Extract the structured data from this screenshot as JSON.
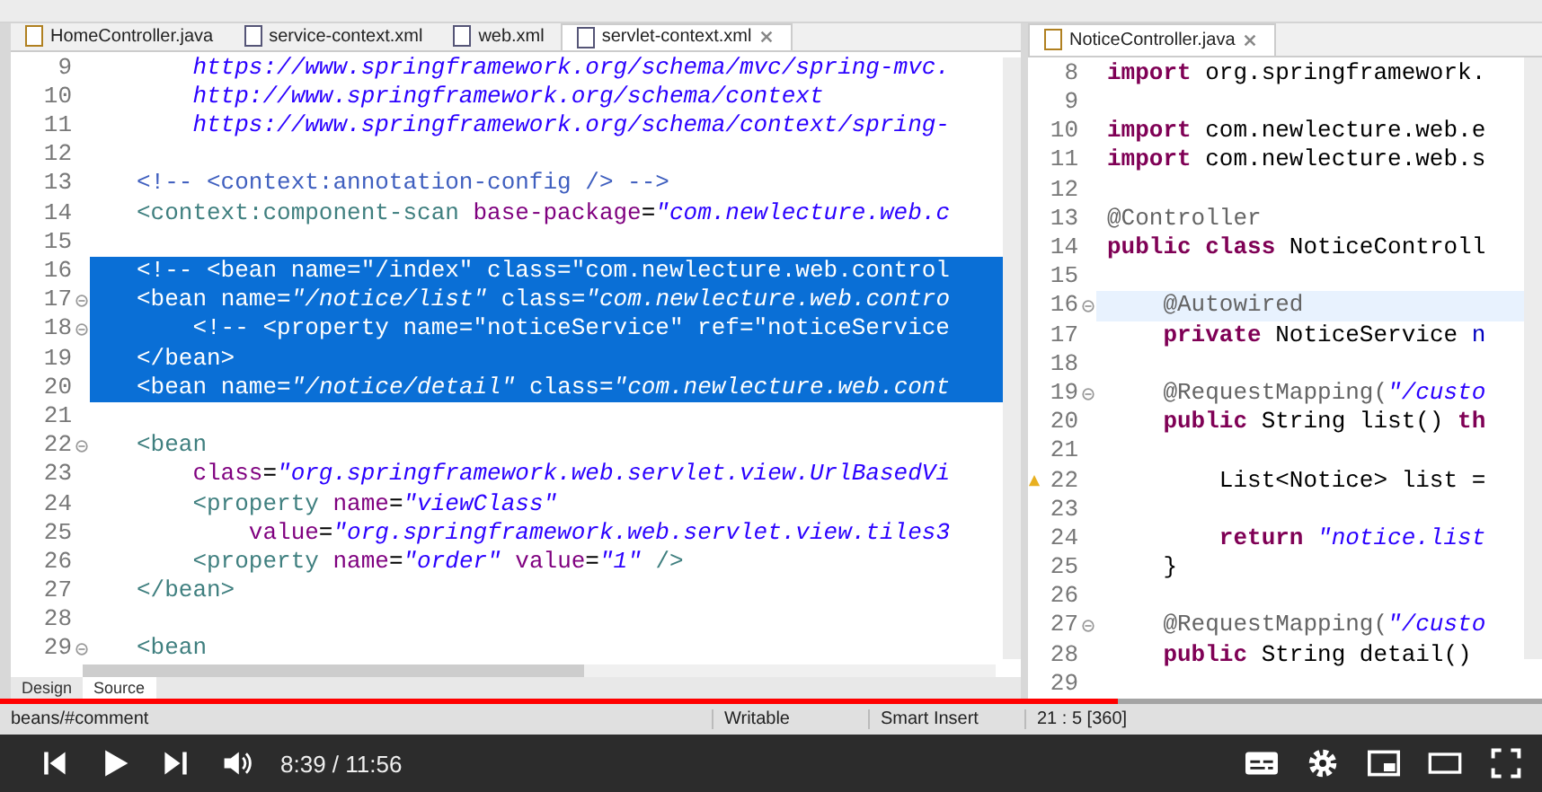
{
  "left_editor": {
    "tabs": [
      {
        "label": "HomeController.java",
        "kind": "java",
        "selected": false
      },
      {
        "label": "service-context.xml",
        "kind": "xml",
        "selected": false
      },
      {
        "label": "web.xml",
        "kind": "xml",
        "selected": false
      },
      {
        "label": "servlet-context.xml",
        "kind": "xml",
        "selected": true
      }
    ],
    "lines": [
      {
        "n": "9",
        "selected": false,
        "fold": false,
        "t": [
          {
            "kind": "value",
            "text": "    https://www.springframework.org/schema/mvc/spring-mvc."
          }
        ]
      },
      {
        "n": "10",
        "selected": false,
        "fold": false,
        "t": [
          {
            "kind": "value",
            "text": "    http://www.springframework.org/schema/context"
          }
        ]
      },
      {
        "n": "11",
        "selected": false,
        "fold": false,
        "t": [
          {
            "kind": "value",
            "text": "    https://www.springframework.org/schema/context/spring-"
          }
        ]
      },
      {
        "n": "12",
        "selected": false,
        "fold": false
      },
      {
        "n": "13",
        "selected": false,
        "fold": false,
        "t": [
          {
            "kind": "comment",
            "text": "<!-- <context:annotation-config /> -->"
          }
        ]
      },
      {
        "n": "14",
        "selected": false,
        "fold": false,
        "t": [
          {
            "kind": "tag",
            "text": "<context:component-scan"
          },
          {
            "kind": "attr",
            "text": " base-package"
          },
          {
            "kind": "plain",
            "text": "="
          },
          {
            "kind": "value",
            "text": "\"com.newlecture.web.c"
          }
        ]
      },
      {
        "n": "15",
        "selected": false,
        "fold": false
      },
      {
        "n": "16",
        "selected": true,
        "fold": false,
        "t": [
          {
            "kind": "comment",
            "text": "<!-- <bean name=\"/index\" class=\"com.newlecture.web.control"
          }
        ]
      },
      {
        "n": "17",
        "selected": true,
        "fold": true,
        "t": [
          {
            "kind": "tag",
            "text": "<bean"
          },
          {
            "kind": "attr",
            "text": " name"
          },
          {
            "kind": "plain",
            "text": "="
          },
          {
            "kind": "value",
            "text": "\"/notice/list\""
          },
          {
            "kind": "attr",
            "text": " class"
          },
          {
            "kind": "plain",
            "text": "="
          },
          {
            "kind": "value",
            "text": "\"com.newlecture.web.contro"
          }
        ]
      },
      {
        "n": "18",
        "selected": true,
        "fold": true,
        "t": [
          {
            "kind": "comment",
            "text": "    <!-- <property name=\"noticeService\" ref=\"noticeService"
          }
        ]
      },
      {
        "n": "19",
        "selected": true,
        "fold": false,
        "t": [
          {
            "kind": "tag",
            "text": "</bean>"
          }
        ]
      },
      {
        "n": "20",
        "selected": true,
        "fold": false,
        "t": [
          {
            "kind": "tag",
            "text": "<bean"
          },
          {
            "kind": "attr",
            "text": " name"
          },
          {
            "kind": "plain",
            "text": "="
          },
          {
            "kind": "value",
            "text": "\"/notice/detail\""
          },
          {
            "kind": "attr",
            "text": " class"
          },
          {
            "kind": "plain",
            "text": "="
          },
          {
            "kind": "value",
            "text": "\"com.newlecture.web.cont"
          }
        ]
      },
      {
        "n": "21",
        "selected": false,
        "fold": false
      },
      {
        "n": "22",
        "selected": false,
        "fold": true,
        "t": [
          {
            "kind": "tag",
            "text": "<bean"
          }
        ]
      },
      {
        "n": "23",
        "selected": false,
        "fold": false,
        "t": [
          {
            "kind": "attr",
            "text": "    class"
          },
          {
            "kind": "plain",
            "text": "="
          },
          {
            "kind": "value",
            "text": "\"org.springframework.web.servlet.view.UrlBasedVi"
          }
        ]
      },
      {
        "n": "24",
        "selected": false,
        "fold": false,
        "t": [
          {
            "kind": "tag",
            "text": "    <property"
          },
          {
            "kind": "attr",
            "text": " name"
          },
          {
            "kind": "plain",
            "text": "="
          },
          {
            "kind": "value",
            "text": "\"viewClass\""
          }
        ]
      },
      {
        "n": "25",
        "selected": false,
        "fold": false,
        "t": [
          {
            "kind": "attr",
            "text": "        value"
          },
          {
            "kind": "plain",
            "text": "="
          },
          {
            "kind": "value",
            "text": "\"org.springframework.web.servlet.view.tiles3"
          }
        ]
      },
      {
        "n": "26",
        "selected": false,
        "fold": false,
        "t": [
          {
            "kind": "tag",
            "text": "    <property"
          },
          {
            "kind": "attr",
            "text": " name"
          },
          {
            "kind": "plain",
            "text": "="
          },
          {
            "kind": "value",
            "text": "\"order\""
          },
          {
            "kind": "attr",
            "text": " value"
          },
          {
            "kind": "plain",
            "text": "="
          },
          {
            "kind": "value",
            "text": "\"1\""
          },
          {
            "kind": "tag",
            "text": " />"
          }
        ]
      },
      {
        "n": "27",
        "selected": false,
        "fold": false,
        "t": [
          {
            "kind": "tag",
            "text": "</bean>"
          }
        ]
      },
      {
        "n": "28",
        "selected": false,
        "fold": false
      },
      {
        "n": "29",
        "selected": false,
        "fold": true,
        "t": [
          {
            "kind": "tag",
            "text": "<bean"
          }
        ]
      }
    ],
    "bottom_tabs": [
      {
        "label": "Design",
        "selected": false
      },
      {
        "label": "Source",
        "selected": true
      }
    ]
  },
  "right_editor": {
    "tabs": [
      {
        "label": "NoticeController.java",
        "kind": "java",
        "selected": true
      }
    ],
    "lines": [
      {
        "n": "8",
        "selected": false,
        "fold": false,
        "warning": false,
        "t": [
          {
            "kind": "keyword",
            "text": "import"
          },
          {
            "kind": "plain",
            "text": " org.springframework."
          }
        ]
      },
      {
        "n": "9",
        "selected": false,
        "fold": false,
        "warning": false
      },
      {
        "n": "10",
        "selected": false,
        "fold": false,
        "warning": false,
        "t": [
          {
            "kind": "keyword",
            "text": "import"
          },
          {
            "kind": "plain",
            "text": " com.newlecture.web.e"
          }
        ]
      },
      {
        "n": "11",
        "selected": false,
        "fold": false,
        "warning": false,
        "t": [
          {
            "kind": "keyword",
            "text": "import"
          },
          {
            "kind": "plain",
            "text": " com.newlecture.web.s"
          }
        ]
      },
      {
        "n": "12",
        "selected": false,
        "fold": false,
        "warning": false
      },
      {
        "n": "13",
        "selected": false,
        "fold": false,
        "warning": false,
        "t": [
          {
            "kind": "annotation",
            "text": "@Controller"
          }
        ]
      },
      {
        "n": "14",
        "selected": false,
        "fold": false,
        "warning": false,
        "t": [
          {
            "kind": "keyword",
            "text": "public class"
          },
          {
            "kind": "plain",
            "text": " NoticeControll"
          }
        ]
      },
      {
        "n": "15",
        "selected": false,
        "fold": false,
        "warning": false
      },
      {
        "n": "16",
        "selected": true,
        "fold": true,
        "warning": false,
        "t": [
          {
            "kind": "annotation",
            "text": "    @Autowired"
          }
        ]
      },
      {
        "n": "17",
        "selected": false,
        "fold": false,
        "warning": false,
        "t": [
          {
            "kind": "keyword",
            "text": "    private"
          },
          {
            "kind": "plain",
            "text": " NoticeService"
          },
          {
            "kind": "field",
            "text": " n"
          }
        ]
      },
      {
        "n": "18",
        "selected": false,
        "fold": false,
        "warning": false
      },
      {
        "n": "19",
        "selected": false,
        "fold": true,
        "warning": false,
        "t": [
          {
            "kind": "annotation",
            "text": "    @RequestMapping("
          },
          {
            "kind": "value",
            "text": "\"/custo"
          }
        ]
      },
      {
        "n": "20",
        "selected": false,
        "fold": false,
        "warning": false,
        "t": [
          {
            "kind": "keyword",
            "text": "    public"
          },
          {
            "kind": "plain",
            "text": " String list()"
          },
          {
            "kind": "keyword",
            "text": " th"
          }
        ]
      },
      {
        "n": "21",
        "selected": false,
        "fold": false,
        "warning": false
      },
      {
        "n": "22",
        "selected": false,
        "fold": false,
        "warning": true,
        "t": [
          {
            "kind": "plain",
            "text": "        List<Notice> list ="
          }
        ]
      },
      {
        "n": "23",
        "selected": false,
        "fold": false,
        "warning": false
      },
      {
        "n": "24",
        "selected": false,
        "fold": false,
        "warning": false,
        "t": [
          {
            "kind": "keyword",
            "text": "        return"
          },
          {
            "kind": "value",
            "text": " \"notice.list"
          }
        ]
      },
      {
        "n": "25",
        "selected": false,
        "fold": false,
        "warning": false,
        "t": [
          {
            "kind": "plain",
            "text": "    }"
          }
        ]
      },
      {
        "n": "26",
        "selected": false,
        "fold": false,
        "warning": false
      },
      {
        "n": "27",
        "selected": false,
        "fold": true,
        "warning": false,
        "t": [
          {
            "kind": "annotation",
            "text": "    @RequestMapping("
          },
          {
            "kind": "value",
            "text": "\"/custo"
          }
        ]
      },
      {
        "n": "28",
        "selected": false,
        "fold": false,
        "warning": false,
        "t": [
          {
            "kind": "keyword",
            "text": "    public"
          },
          {
            "kind": "plain",
            "text": " String detail()"
          }
        ]
      },
      {
        "n": "29",
        "selected": false,
        "fold": false,
        "warning": false
      }
    ]
  },
  "status_bar": {
    "path": "beans/#comment",
    "mode": "Writable",
    "insert": "Smart Insert",
    "position": "21 : 5 [360]"
  },
  "player": {
    "progress": {
      "level": 0.725
    },
    "time": "8:39 / 11:56"
  }
}
